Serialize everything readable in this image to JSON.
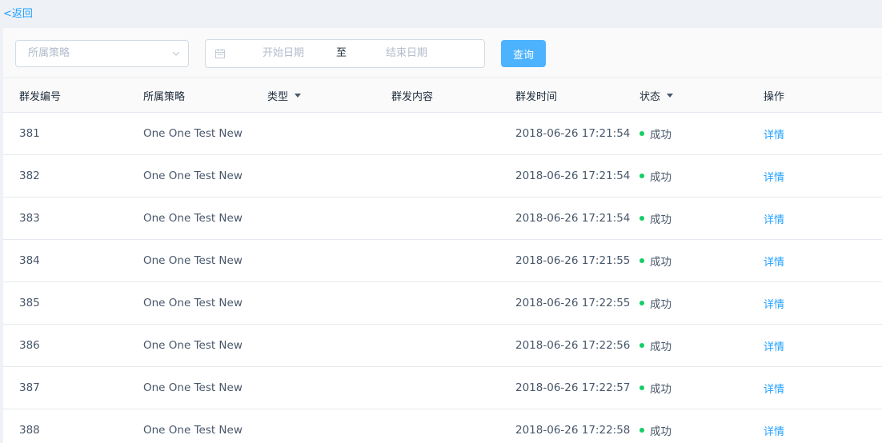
{
  "header": {
    "back_label": "<返回"
  },
  "filters": {
    "strategy_placeholder": "所属策略",
    "start_date_placeholder": "开始日期",
    "date_separator": "至",
    "end_date_placeholder": "结束日期",
    "query_label": "查询"
  },
  "table": {
    "columns": [
      "群发编号",
      "所属策略",
      "类型",
      "群发内容",
      "群发时间",
      "状态",
      "操作"
    ],
    "rows": [
      {
        "id": "381",
        "strategy": "One One Test New",
        "type": "",
        "content": "",
        "time": "2018-06-26 17:21:54",
        "status": "成功",
        "action": "详情"
      },
      {
        "id": "382",
        "strategy": "One One Test New",
        "type": "",
        "content": "",
        "time": "2018-06-26 17:21:54",
        "status": "成功",
        "action": "详情"
      },
      {
        "id": "383",
        "strategy": "One One Test New",
        "type": "",
        "content": "",
        "time": "2018-06-26 17:21:54",
        "status": "成功",
        "action": "详情"
      },
      {
        "id": "384",
        "strategy": "One One Test New",
        "type": "",
        "content": "",
        "time": "2018-06-26 17:21:55",
        "status": "成功",
        "action": "详情"
      },
      {
        "id": "385",
        "strategy": "One One Test New",
        "type": "",
        "content": "",
        "time": "2018-06-26 17:22:55",
        "status": "成功",
        "action": "详情"
      },
      {
        "id": "386",
        "strategy": "One One Test New",
        "type": "",
        "content": "",
        "time": "2018-06-26 17:22:56",
        "status": "成功",
        "action": "详情"
      },
      {
        "id": "387",
        "strategy": "One One Test New",
        "type": "",
        "content": "",
        "time": "2018-06-26 17:22:57",
        "status": "成功",
        "action": "详情"
      },
      {
        "id": "388",
        "strategy": "One One Test New",
        "type": "",
        "content": "",
        "time": "2018-06-26 17:22:58",
        "status": "成功",
        "action": "详情"
      }
    ]
  },
  "icons": {
    "strategy_dropdown": "chevron-down-icon",
    "date_range": "calendar-icon",
    "type_filter": "caret-down-icon",
    "status_filter": "caret-down-icon",
    "status_indicator": "status-dot-icon"
  },
  "colors": {
    "accent": "#20a0ff",
    "button": "#4db3ff",
    "success": "#13ce66"
  }
}
